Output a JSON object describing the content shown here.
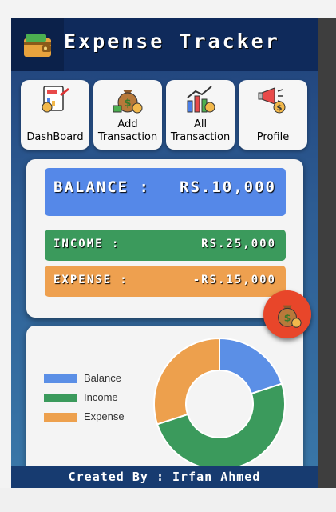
{
  "header": {
    "title": "Expense Tracker",
    "logo_icon": "wallet-icon"
  },
  "nav": [
    {
      "label": "DashBoard",
      "icon": "dashboard-icon"
    },
    {
      "label": "Add\nTransaction",
      "icon": "money-bag-icon"
    },
    {
      "label": "All\nTransaction",
      "icon": "bar-chart-icon"
    },
    {
      "label": "Profile",
      "icon": "megaphone-icon"
    }
  ],
  "summary": {
    "balance_label": "BALANCE :",
    "balance_value": "RS.10,000",
    "income_label": "INCOME :",
    "income_value": "RS.25,000",
    "expense_label": "EXPENSE :",
    "expense_value": "-RS.15,000"
  },
  "fab": {
    "icon": "money-bag-icon"
  },
  "chart_data": {
    "type": "pie",
    "categories": [
      "Balance",
      "Income",
      "Expense"
    ],
    "values": [
      10000,
      25000,
      15000
    ],
    "colors": [
      "#5b8fe6",
      "#3b9a5c",
      "#eda04d"
    ],
    "legend": "left"
  },
  "footer": {
    "text": "Created By : Irfan Ahmed"
  }
}
